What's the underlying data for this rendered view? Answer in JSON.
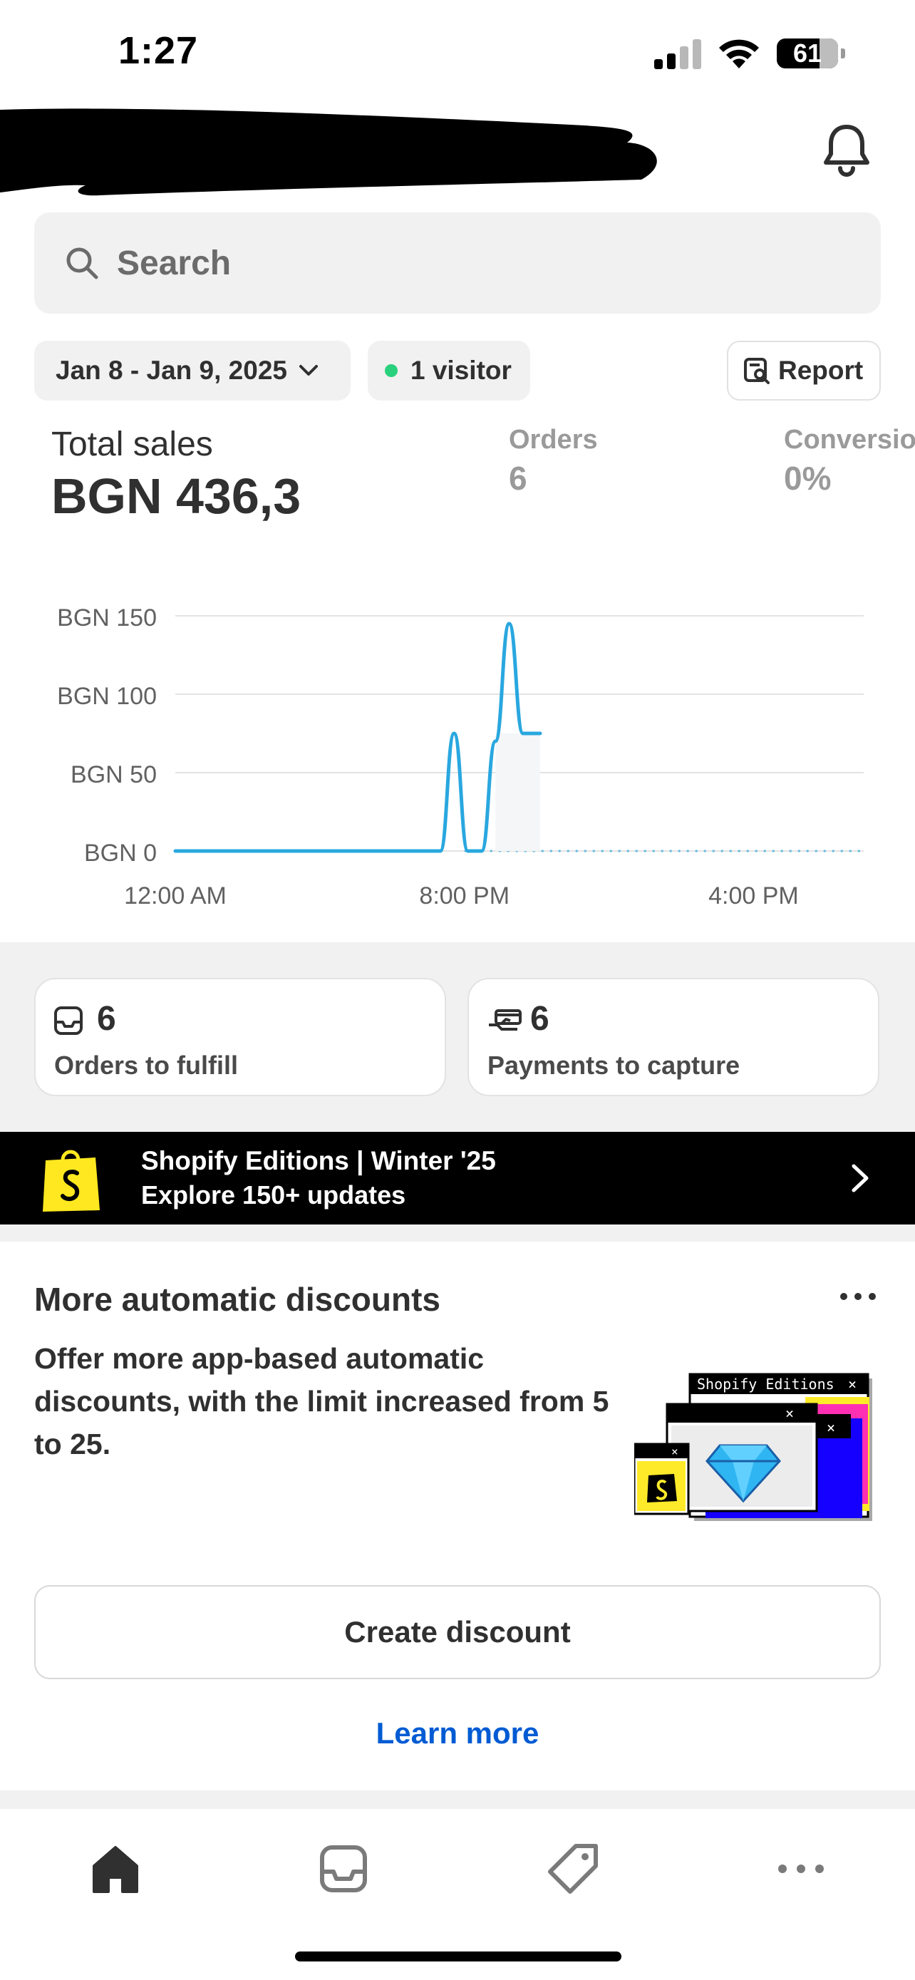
{
  "status_bar": {
    "time": "1:27",
    "battery": "61"
  },
  "header": {
    "search_placeholder": "Search"
  },
  "filters": {
    "date_range": "Jan 8 - Jan 9, 2025",
    "visitors": "1 visitor",
    "report_label": "Report"
  },
  "metrics": {
    "total_sales_label": "Total sales",
    "total_sales_value": "BGN 436,3",
    "orders_label": "Orders",
    "orders_value": "6",
    "conversion_label": "Conversion",
    "conversion_value": "0%"
  },
  "chart_data": {
    "type": "line",
    "y_ticks": [
      "BGN 150",
      "BGN 100",
      "BGN 50",
      "BGN 0"
    ],
    "y_values": [
      150,
      100,
      50,
      0
    ],
    "x_ticks": [
      "12:00 AM",
      "8:00 PM",
      "4:00 PM"
    ],
    "ylim": [
      0,
      150
    ],
    "series": [
      {
        "values": [
          0,
          0,
          0,
          0,
          0,
          75,
          0,
          0,
          70,
          145,
          75,
          75
        ]
      }
    ],
    "comparison_series_style": "dotted baseline at 0",
    "grid": true,
    "line_color": "#29a7df"
  },
  "tasks": [
    {
      "count": "6",
      "label": "Orders to fulfill",
      "icon": "inbox-icon"
    },
    {
      "count": "6",
      "label": "Payments to capture",
      "icon": "hand-card-icon"
    }
  ],
  "banner": {
    "line1": "Shopify Editions | Winter '25",
    "line2": "Explore 150+ updates"
  },
  "discount_card": {
    "title": "More automatic discounts",
    "description": "Offer more app-based automatic discounts, with the limit increased from 5 to 25.",
    "illustration_caption": "Shopify Editions",
    "create_button": "Create discount",
    "learn_more": "Learn more"
  },
  "tab_bar": {
    "items": [
      "home-icon",
      "orders-icon",
      "products-icon",
      "more-icon"
    ]
  },
  "colors": {
    "accent_link": "#005bd3",
    "chart_line": "#29a7df",
    "visitor_dot": "#29d17c"
  }
}
